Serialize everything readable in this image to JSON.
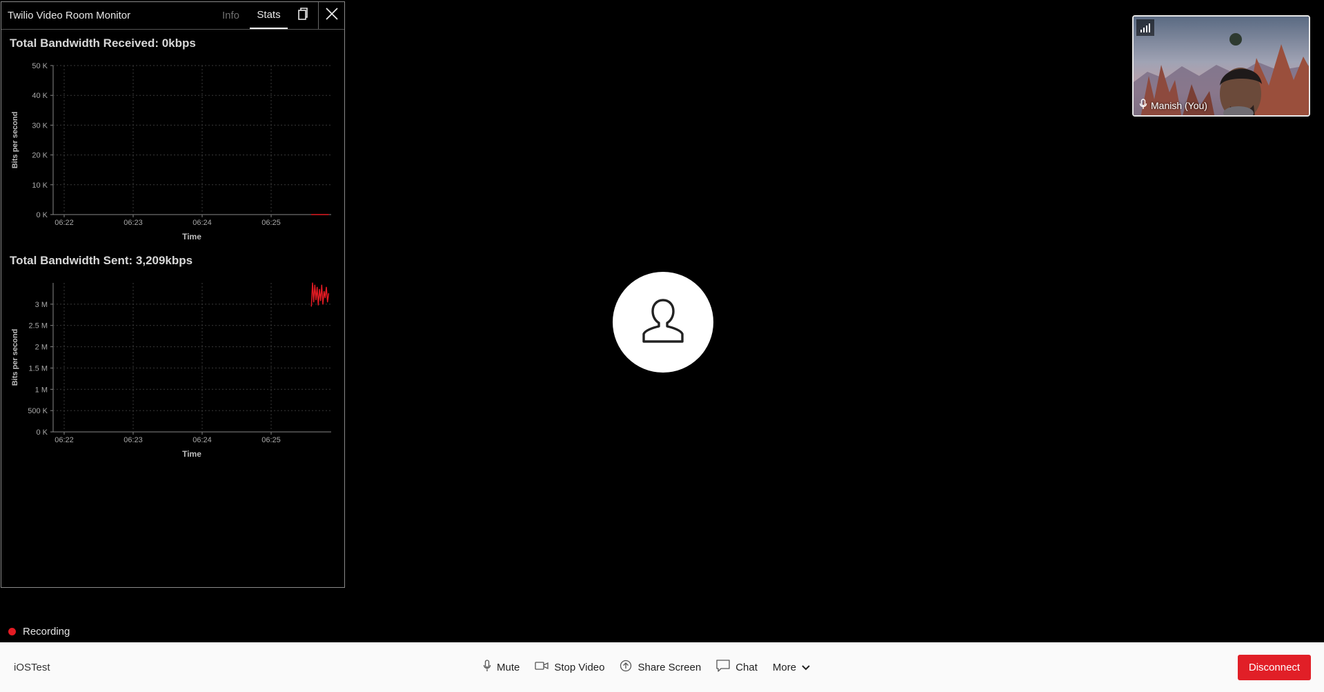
{
  "monitor": {
    "title": "Twilio Video Room Monitor",
    "tabs": [
      {
        "label": "Info",
        "active": false
      },
      {
        "label": "Stats",
        "active": true
      }
    ],
    "copy_icon": "copy-icon",
    "close_icon": "close-icon"
  },
  "charts": {
    "received_title": "Total Bandwidth Received: 0kbps",
    "sent_title": "Total Bandwidth Sent: 3,209kbps"
  },
  "chart_data": [
    {
      "type": "line",
      "title": "Total Bandwidth Received: 0kbps",
      "xlabel": "Time",
      "ylabel": "Bits per second",
      "x_ticks": [
        "06:22",
        "06:23",
        "06:24",
        "06:25"
      ],
      "y_ticks": [
        "0 K",
        "10 K",
        "20 K",
        "30 K",
        "40 K",
        "50 K"
      ],
      "ylim": [
        0,
        50000
      ],
      "grid": true,
      "series_color": "#e31b23",
      "series": [
        {
          "x": [
            "06:25:35",
            "06:25:50"
          ],
          "values": [
            0,
            0
          ]
        }
      ]
    },
    {
      "type": "line",
      "title": "Total Bandwidth Sent: 3,209kbps",
      "xlabel": "Time",
      "ylabel": "Bits per second",
      "x_ticks": [
        "06:22",
        "06:23",
        "06:24",
        "06:25"
      ],
      "y_ticks": [
        "0 K",
        "500 K",
        "1 M",
        "1.5 M",
        "2 M",
        "2.5 M",
        "3 M"
      ],
      "ylim": [
        0,
        3500000
      ],
      "grid": true,
      "series_color": "#e31b23",
      "series": [
        {
          "x": [
            "06:25:35",
            "06:25:36",
            "06:25:37",
            "06:25:38",
            "06:25:39",
            "06:25:40",
            "06:25:41",
            "06:25:42",
            "06:25:43",
            "06:25:44",
            "06:25:45",
            "06:25:46",
            "06:25:47",
            "06:25:48",
            "06:25:49",
            "06:25:50"
          ],
          "values": [
            2950000,
            3500000,
            3050000,
            3450000,
            3100000,
            3400000,
            2980000,
            3350000,
            3080000,
            3450000,
            3000000,
            3300000,
            3150000,
            3400000,
            3050000,
            3250000
          ]
        }
      ]
    }
  ],
  "main": {
    "avatar_icon": "user-icon"
  },
  "local": {
    "name": "Manish (You)",
    "signal_icon": "signal-bars-icon",
    "mic_icon": "microphone-icon"
  },
  "status": {
    "recording_label": "Recording",
    "recording_color": "#e31b23"
  },
  "bottom_bar": {
    "room_name": "iOSTest",
    "mute_label": "Mute",
    "stop_video_label": "Stop Video",
    "share_screen_label": "Share Screen",
    "chat_label": "Chat",
    "more_label": "More",
    "disconnect_label": "Disconnect",
    "disconnect_color": "#e11f27"
  }
}
